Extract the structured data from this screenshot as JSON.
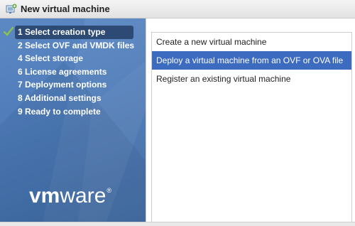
{
  "window": {
    "title": "New virtual machine",
    "icon": "new-vm-icon"
  },
  "sidebar": {
    "steps": [
      {
        "label": "1 Select creation type",
        "active": true,
        "completed": true
      },
      {
        "label": "2 Select OVF and VMDK files",
        "active": false,
        "completed": false
      },
      {
        "label": "4 Select storage",
        "active": false,
        "completed": false
      },
      {
        "label": "6 License agreements",
        "active": false,
        "completed": false
      },
      {
        "label": "7 Deployment options",
        "active": false,
        "completed": false
      },
      {
        "label": "8 Additional settings",
        "active": false,
        "completed": false
      },
      {
        "label": "9 Ready to complete",
        "active": false,
        "completed": false
      }
    ],
    "logo": {
      "vm": "vm",
      "ware": "ware",
      "reg": "®"
    }
  },
  "creation_types": {
    "options": [
      {
        "label": "Create a new virtual machine",
        "selected": false
      },
      {
        "label": "Deploy a virtual machine from an OVF or OVA file",
        "selected": true
      },
      {
        "label": "Register an existing virtual machine",
        "selected": false
      }
    ]
  },
  "colors": {
    "sidebar": "#4f7cb9",
    "active_step": "#2c4a73",
    "selected_option": "#3d6bbf",
    "check": "#8bc34a"
  }
}
